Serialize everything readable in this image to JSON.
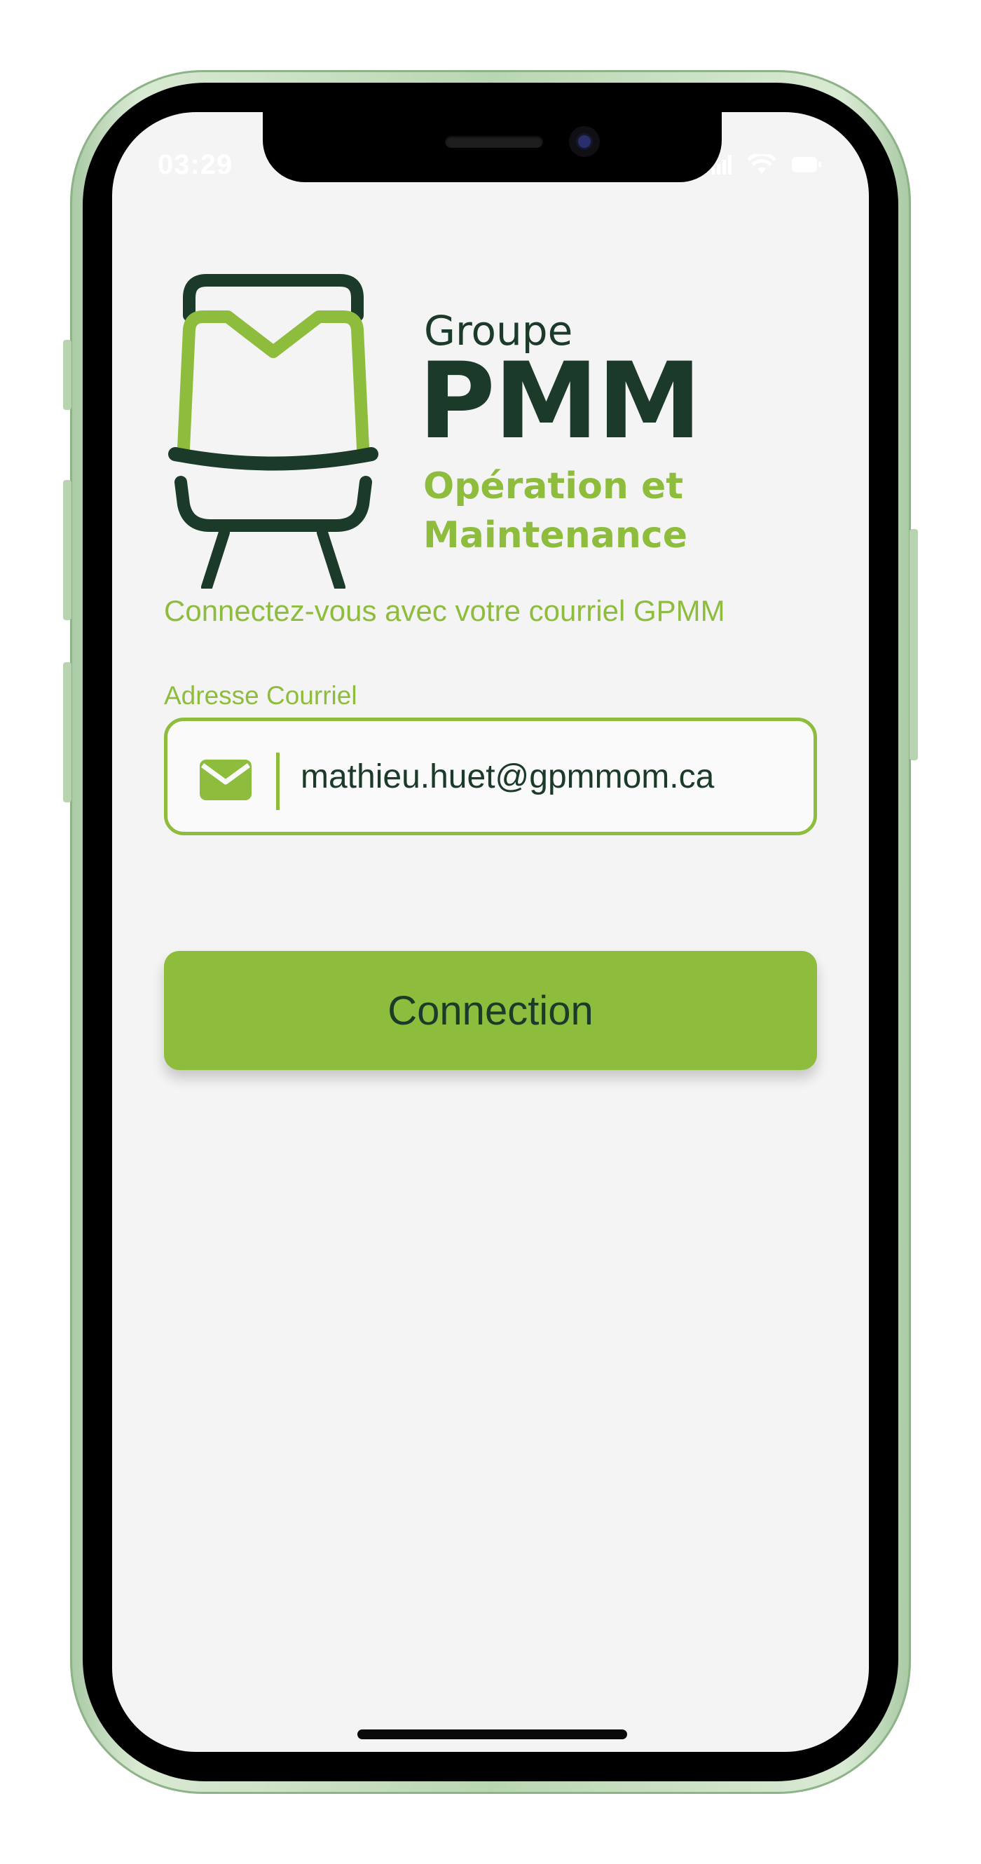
{
  "status_bar": {
    "time": "03:29",
    "wifi_icon": "wifi-icon",
    "battery_icon": "battery-icon"
  },
  "logo": {
    "line1": "Groupe",
    "line2": "PMM",
    "line3": "Opération et",
    "line4": "Maintenance",
    "mark_icon": "train-icon"
  },
  "login": {
    "instruction": "Connectez-vous avec votre courriel GPMM",
    "email_label": "Adresse Courriel",
    "email_value": "mathieu.huet@gpmmom.ca",
    "email_icon": "envelope-icon",
    "submit_label": "Connection"
  },
  "colors": {
    "accent_green": "#8ebd3d",
    "dark_green": "#1b3a2a",
    "screen_background": "#f4f4f4"
  }
}
